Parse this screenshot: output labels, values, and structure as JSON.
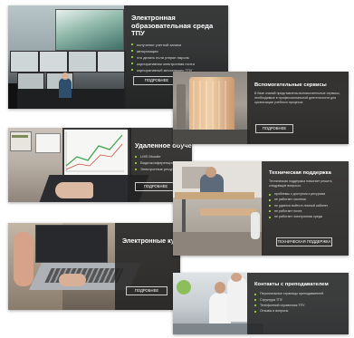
{
  "cards": [
    {
      "title": "Электронная образовательная среда ТПУ",
      "bullets": [
        "получение учетной записи",
        "авторизация",
        "что делать если утерян пароль",
        "корпоративная электронная почта",
        "корпоративный мессенджер ТПУ"
      ],
      "button": "ПОДРОБНЕЕ"
    },
    {
      "title": "Вспомогательные сервисы",
      "description": "В базе знаний представлены вспомогательные сервисы, необходимые в профессиональной деятельности для организации учебного процесса",
      "button": "ПОДРОБНЕЕ"
    },
    {
      "title": "Удаленное обучение",
      "bullets": [
        "LMS Moodle",
        "Видеоконференции",
        "Электронные ресурсы"
      ],
      "button": "ПОДРОБНЕЕ"
    },
    {
      "title": "Техническая поддержка",
      "description": "Техническая поддержка помогает решить следующие вопросы:",
      "bullets": [
        "проблемы с доступом к ресурсам",
        "не работает система",
        "не удается войти в личный кабинет",
        "не работает почта",
        "не работает электронная среда"
      ],
      "button": "ТЕХНИЧЕСКАЯ ПОДДЕРЖКА"
    },
    {
      "title": "Электронные курсы",
      "button": "ПОДРОБНЕЕ"
    },
    {
      "title": "Контакты с преподавателем",
      "bullets": [
        "Персональные страницы преподавателей",
        "Структура ТПУ",
        "Телефонный справочник ТПУ",
        "Отзывы и вопросы"
      ]
    }
  ]
}
